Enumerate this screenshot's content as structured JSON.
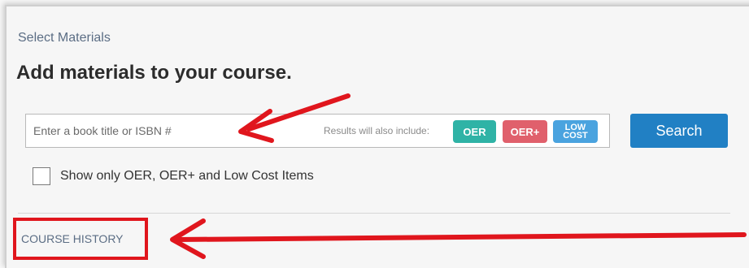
{
  "header": {
    "section_label": "Select Materials",
    "title": "Add materials to your course."
  },
  "search": {
    "placeholder": "Enter a book title or ISBN #",
    "value": "",
    "results_note": "Results will also include:",
    "badges": [
      "OER",
      "OER+",
      "LOW",
      "COST"
    ],
    "button_label": "Search"
  },
  "filter": {
    "checkbox_label": "Show only OER, OER+ and Low Cost Items",
    "checked": false
  },
  "course_history": {
    "label": "COURSE HISTORY"
  },
  "colors": {
    "accent": "#2180c4",
    "oer": "#2fb3a6",
    "oer_plus": "#e0606c",
    "low_cost": "#4aa3df",
    "annotation_red": "#e0161d"
  },
  "icons": [
    "arrow-annotation-icon"
  ]
}
